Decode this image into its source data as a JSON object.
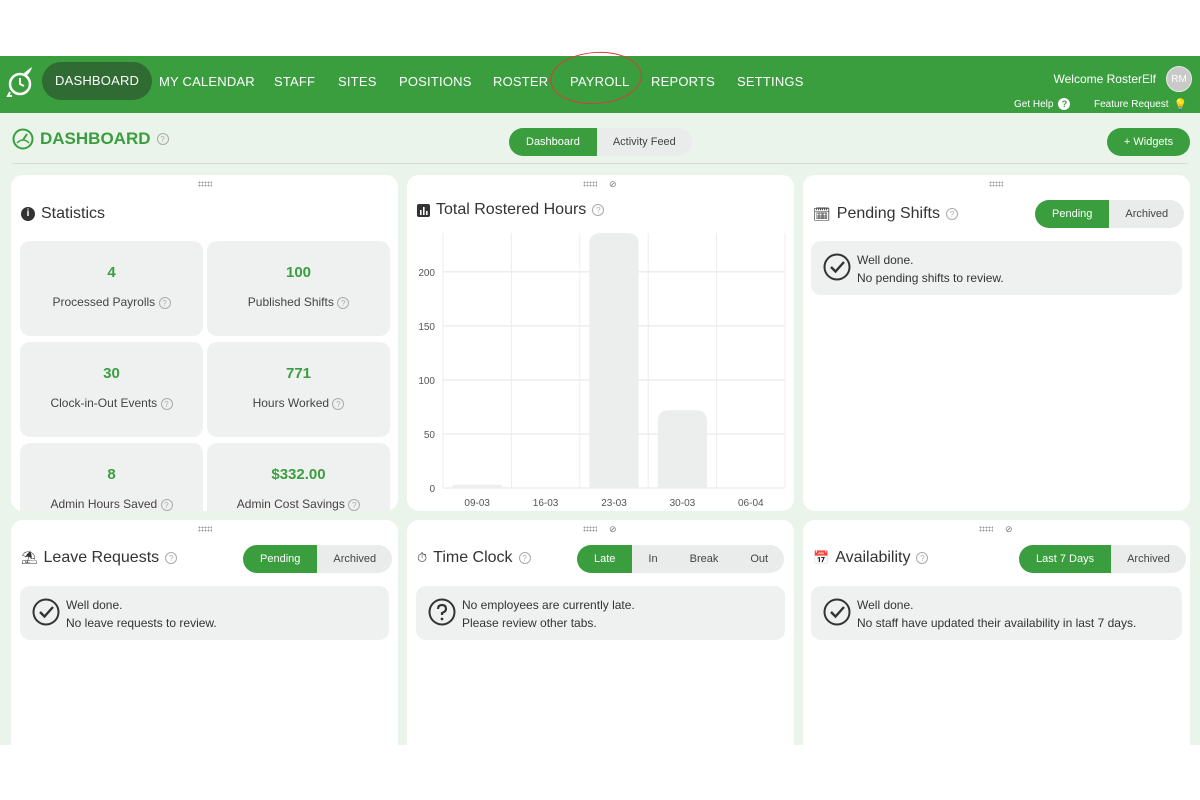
{
  "nav": {
    "items": [
      "DASHBOARD",
      "MY CALENDAR",
      "STAFF",
      "SITES",
      "POSITIONS",
      "ROSTER",
      "PAYROLL",
      "REPORTS",
      "SETTINGS"
    ],
    "active": "DASHBOARD",
    "welcome": "Welcome RosterElf",
    "avatar_initials": "RM",
    "get_help": "Get Help",
    "feature_request": "Feature Request"
  },
  "page": {
    "title": "DASHBOARD",
    "tabs": [
      "Dashboard",
      "Activity Feed"
    ],
    "active_tab": "Dashboard",
    "widgets_button": "+ Widgets"
  },
  "statistics": {
    "title": "Statistics",
    "tiles": [
      {
        "value": "4",
        "label": "Processed Payrolls"
      },
      {
        "value": "100",
        "label": "Published Shifts"
      },
      {
        "value": "30",
        "label": "Clock-in-Out Events"
      },
      {
        "value": "771",
        "label": "Hours Worked"
      },
      {
        "value": "8",
        "label": "Admin Hours Saved"
      },
      {
        "value": "$332.00",
        "label": "Admin Cost Savings"
      }
    ]
  },
  "chart_card": {
    "title": "Total Rostered Hours"
  },
  "chart_data": {
    "type": "bar",
    "categories": [
      "09-03",
      "16-03",
      "23-03",
      "30-03",
      "06-04"
    ],
    "values": [
      3,
      0,
      236,
      72,
      0
    ],
    "ylim": [
      0,
      236
    ],
    "yticks": [
      0,
      50,
      100,
      150,
      200
    ],
    "grid": true
  },
  "pending_shifts": {
    "title": "Pending Shifts",
    "tabs": [
      "Pending",
      "Archived"
    ],
    "line1": "Well done.",
    "line2": "No pending shifts to review."
  },
  "leave_requests": {
    "title": "Leave Requests",
    "tabs": [
      "Pending",
      "Archived"
    ],
    "line1": "Well done.",
    "line2": "No leave requests to review."
  },
  "time_clock": {
    "title": "Time Clock",
    "tabs": [
      "Late",
      "In",
      "Break",
      "Out"
    ],
    "line1": "No employees are currently late.",
    "line2": "Please review other tabs."
  },
  "availability": {
    "title": "Availability",
    "tabs": [
      "Last 7 Days",
      "Archived"
    ],
    "line1": "Well done.",
    "line2": "No staff have updated their availability in last 7 days."
  },
  "colors": {
    "brand": "#3a9e3f",
    "brand_dark": "#2f6b32",
    "highlight_circle": "#d83a3a"
  }
}
